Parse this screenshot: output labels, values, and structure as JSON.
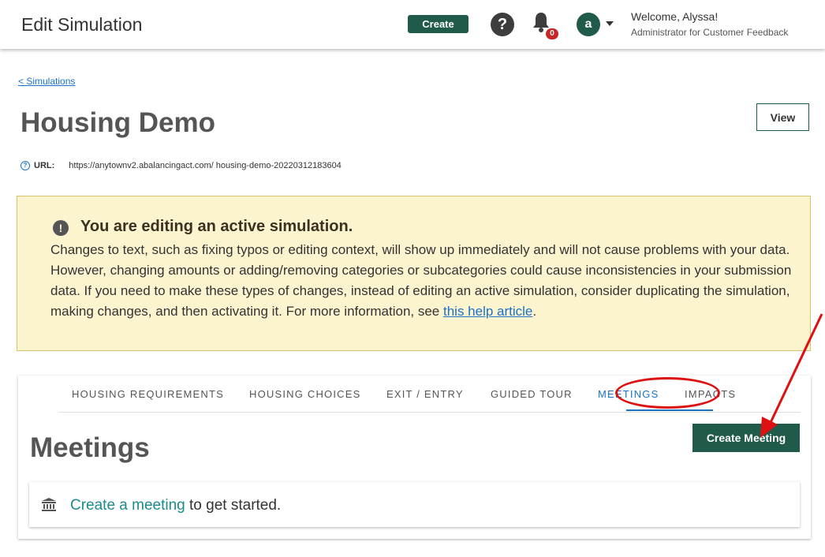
{
  "header": {
    "title": "Edit Simulation",
    "create_label": "Create",
    "help_label": "?",
    "notification_count": "0",
    "avatar_letter": "a",
    "welcome": "Welcome, Alyssa!",
    "role": "Administrator for Customer Feedback"
  },
  "breadcrumb": "< Simulations",
  "simulation": {
    "title": "Housing Demo",
    "view_label": "View",
    "url_label": "URL:",
    "url_value": "https://anytownv2.abalancingact.com/ housing-demo-20220312183604"
  },
  "alert": {
    "title": "You are editing an active simulation.",
    "body": "Changes to text, such as fixing typos or editing context, will show up immediately and will not cause problems with your data. However, changing amounts or adding/removing categories or subcategories could cause inconsistencies in your submission data. If you need to make these types of changes, instead of editing an active simulation, consider duplicating the simulation, making changes, and then activating it. For more information, see",
    "link_text": "this help article",
    "trailing": "."
  },
  "tabs": [
    {
      "label": "HOUSING REQUIREMENTS",
      "active": false
    },
    {
      "label": "HOUSING CHOICES",
      "active": false
    },
    {
      "label": "EXIT / ENTRY",
      "active": false
    },
    {
      "label": "GUIDED TOUR",
      "active": false
    },
    {
      "label": "MEETINGS",
      "active": true
    },
    {
      "label": "IMPACTS",
      "active": false
    }
  ],
  "meetings": {
    "heading": "Meetings",
    "create_button": "Create Meeting",
    "empty_link": "Create a meeting",
    "empty_text": " to get started."
  },
  "colors": {
    "primary": "#1f5a4a",
    "link": "#1a73c8",
    "alert_bg": "#fcf3cf",
    "annotation_red": "#dd1111"
  }
}
